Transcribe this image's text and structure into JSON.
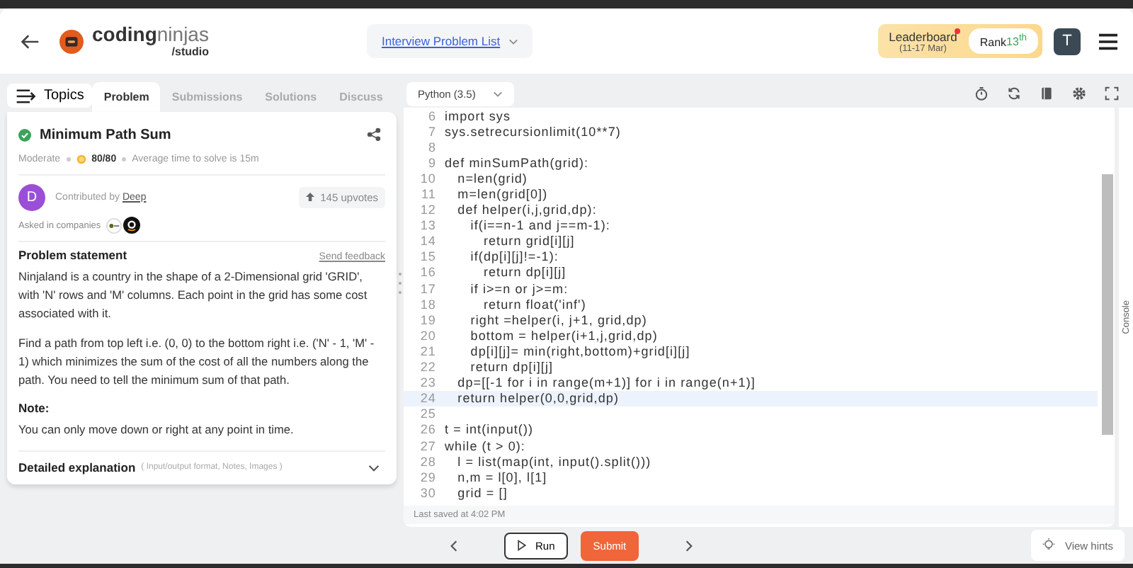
{
  "header": {
    "logo_bold": "coding",
    "logo_light": "ninjas",
    "logo_sub": "/studio",
    "nav_dropdown": "Interview Problem List",
    "leaderboard": {
      "label": "Leaderboard",
      "dates": "(11-17 Mar)",
      "rank_label": "Rank",
      "rank": "13$^{th}$"
    },
    "avatar": "T"
  },
  "tabs": {
    "topics": "Topics",
    "items": [
      {
        "label": "Problem",
        "selected": true
      },
      {
        "label": "Submissions",
        "selected": false
      },
      {
        "label": "Solutions",
        "selected": false
      },
      {
        "label": "Discuss",
        "selected": false
      }
    ]
  },
  "problem": {
    "title": "Minimum Path Sum",
    "solved": true,
    "difficulty": "Moderate",
    "score": "80/80",
    "avg_time": "Average time to solve is 15m",
    "contributor_avatar": "D",
    "contributed_by": "Contributed by",
    "contributor": "Deep",
    "upvotes": "145 upvotes",
    "companies_label": "Asked in companies",
    "statement_heading": "Problem statement",
    "feedback": "Send feedback",
    "paragraphs": [
      "Ninjaland is a country in the shape of a 2-Dimensional grid 'GRID', with 'N' rows and 'M' columns. Each point in the grid has some cost associated with it.",
      "Find a path from top left i.e. (0, 0) to the bottom right i.e. ('N' - 1, 'M' - 1) which minimizes the sum of the cost of all the numbers along the path. You need to tell the minimum sum of that path."
    ],
    "note_heading": "Note:",
    "note": "You can only move down or right at any point in time.",
    "details_heading": "Detailed explanation",
    "details_hint": "( Input/output format, Notes, Images )"
  },
  "editor": {
    "language": "Python (3.5)",
    "last_saved": "Last saved at 4:02 PM",
    "lines": [
      {
        "n": "6",
        "code": "import sys",
        "highlighted": false
      },
      {
        "n": "7",
        "code": "sys.setrecursionlimit(10**7)",
        "highlighted": false
      },
      {
        "n": "8",
        "highlighted": false
      },
      {
        "n": "9",
        "code": "def minSumPath(grid):",
        "highlighted": false
      },
      {
        "n": "10",
        "code": "   n=len(grid)",
        "highlighted": false
      },
      {
        "n": "11",
        "code": "   m=len(grid[0])",
        "highlighted": false
      },
      {
        "n": "12",
        "code": "   def helper(i,j,grid,dp):",
        "highlighted": false
      },
      {
        "n": "13",
        "code": "      if(i==n-1 and j==m-1):",
        "highlighted": false
      },
      {
        "n": "14",
        "code": "         return grid[i][j]",
        "highlighted": false
      },
      {
        "n": "15",
        "code": "      if(dp[i][j]!=-1):",
        "highlighted": false
      },
      {
        "n": "16",
        "code": "         return dp[i][j]",
        "highlighted": false
      },
      {
        "n": "17",
        "code": "      if i>=n or j>=m:",
        "highlighted": false
      },
      {
        "n": "18",
        "code": "         return float('inf')",
        "highlighted": false
      },
      {
        "n": "19",
        "code": "      right =helper(i, j+1, grid,dp)",
        "highlighted": false
      },
      {
        "n": "20",
        "code": "      bottom = helper(i+1,j,grid,dp)",
        "highlighted": false
      },
      {
        "n": "21",
        "code": "      dp[i][j]= min(right,bottom)+grid[i][j]",
        "highlighted": false
      },
      {
        "n": "22",
        "code": "      return dp[i][j]",
        "highlighted": false
      },
      {
        "n": "23",
        "code": "   dp=[[-1 for i in range(m+1)] for i in range(n+1)]",
        "highlighted": false
      },
      {
        "n": "24",
        "code": "   return helper(0,0,grid,dp)",
        "highlighted": true
      },
      {
        "n": "25",
        "highlighted": false
      },
      {
        "n": "26",
        "code": "t = int(input())",
        "highlighted": false
      },
      {
        "n": "27",
        "code": "while (t > 0):",
        "highlighted": false
      },
      {
        "n": "28",
        "code": "   l = list(map(int, input().split()))",
        "highlighted": false
      },
      {
        "n": "29",
        "code": "   n,m = l[0], l[1]",
        "highlighted": false
      },
      {
        "n": "30",
        "code": "   grid = []",
        "highlighted": false
      }
    ]
  },
  "console_label": "Console",
  "footer": {
    "run": "Run",
    "submit": "Submit",
    "hints": "View hints"
  }
}
